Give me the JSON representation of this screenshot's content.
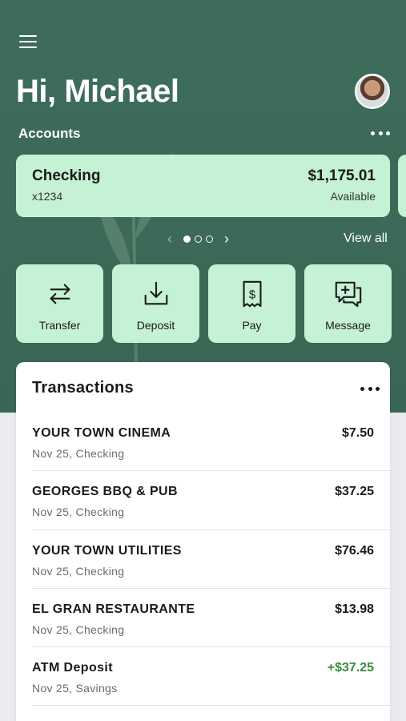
{
  "header": {
    "greeting": "Hi, Michael",
    "accounts_label": "Accounts"
  },
  "account_card": {
    "name": "Checking",
    "number": "x1234",
    "balance": "$1,175.01",
    "balance_label": "Available"
  },
  "pager": {
    "page_count": 3,
    "active_page": 1,
    "view_all_label": "View all"
  },
  "actions": [
    {
      "label": "Transfer",
      "icon": "transfer-icon"
    },
    {
      "label": "Deposit",
      "icon": "deposit-icon"
    },
    {
      "label": "Pay",
      "icon": "pay-icon"
    },
    {
      "label": "Message",
      "icon": "message-icon"
    }
  ],
  "transactions": {
    "title": "Transactions",
    "items": [
      {
        "merchant": "YOUR TOWN CINEMA",
        "meta": "Nov 25, Checking",
        "amount": "$7.50",
        "credit": false
      },
      {
        "merchant": "GEORGES BBQ & PUB",
        "meta": "Nov 25, Checking",
        "amount": "$37.25",
        "credit": false
      },
      {
        "merchant": "YOUR TOWN UTILITIES",
        "meta": "Nov 25, Checking",
        "amount": "$76.46",
        "credit": false
      },
      {
        "merchant": "EL GRAN RESTAURANTE",
        "meta": "Nov 25, Checking",
        "amount": "$13.98",
        "credit": false
      },
      {
        "merchant": "ATM Deposit",
        "meta": "Nov 25, Savings",
        "amount": "+$37.25",
        "credit": true
      }
    ]
  },
  "colors": {
    "hero_green": "#3c6a58",
    "card_mint": "#c5f2d4",
    "credit_green": "#3a8a3a"
  }
}
